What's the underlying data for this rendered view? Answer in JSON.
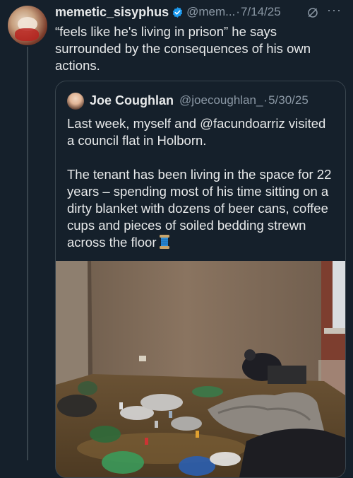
{
  "tweet": {
    "author_name": "memetic_sisyphus",
    "handle": "@mem...",
    "separator": "·",
    "date": "7/14/25",
    "more_label": "···",
    "text": "“feels like he's living in prison” he says surrounded by the consequences of his own actions."
  },
  "quoted": {
    "author_name": "Joe Coughlan",
    "handle": "@joecoughlan_",
    "separator": "·",
    "date": "5/30/25",
    "paragraph_1": "Last week, myself and @facundoarriz visited a council flat in Holborn.",
    "paragraph_2": "The tenant has been living in the space for 22 years – spending most of his time sitting on a dirty blanket with dozens of beer cans, coffee cups and pieces of soiled bedding strewn across the floor",
    "emoji_icon": "spool-of-thread-icon"
  },
  "colors": {
    "background": "#15202b",
    "text": "#e7e9ea",
    "muted": "#8b98a5",
    "border": "#38444d",
    "verified": "#1d9bf0"
  }
}
